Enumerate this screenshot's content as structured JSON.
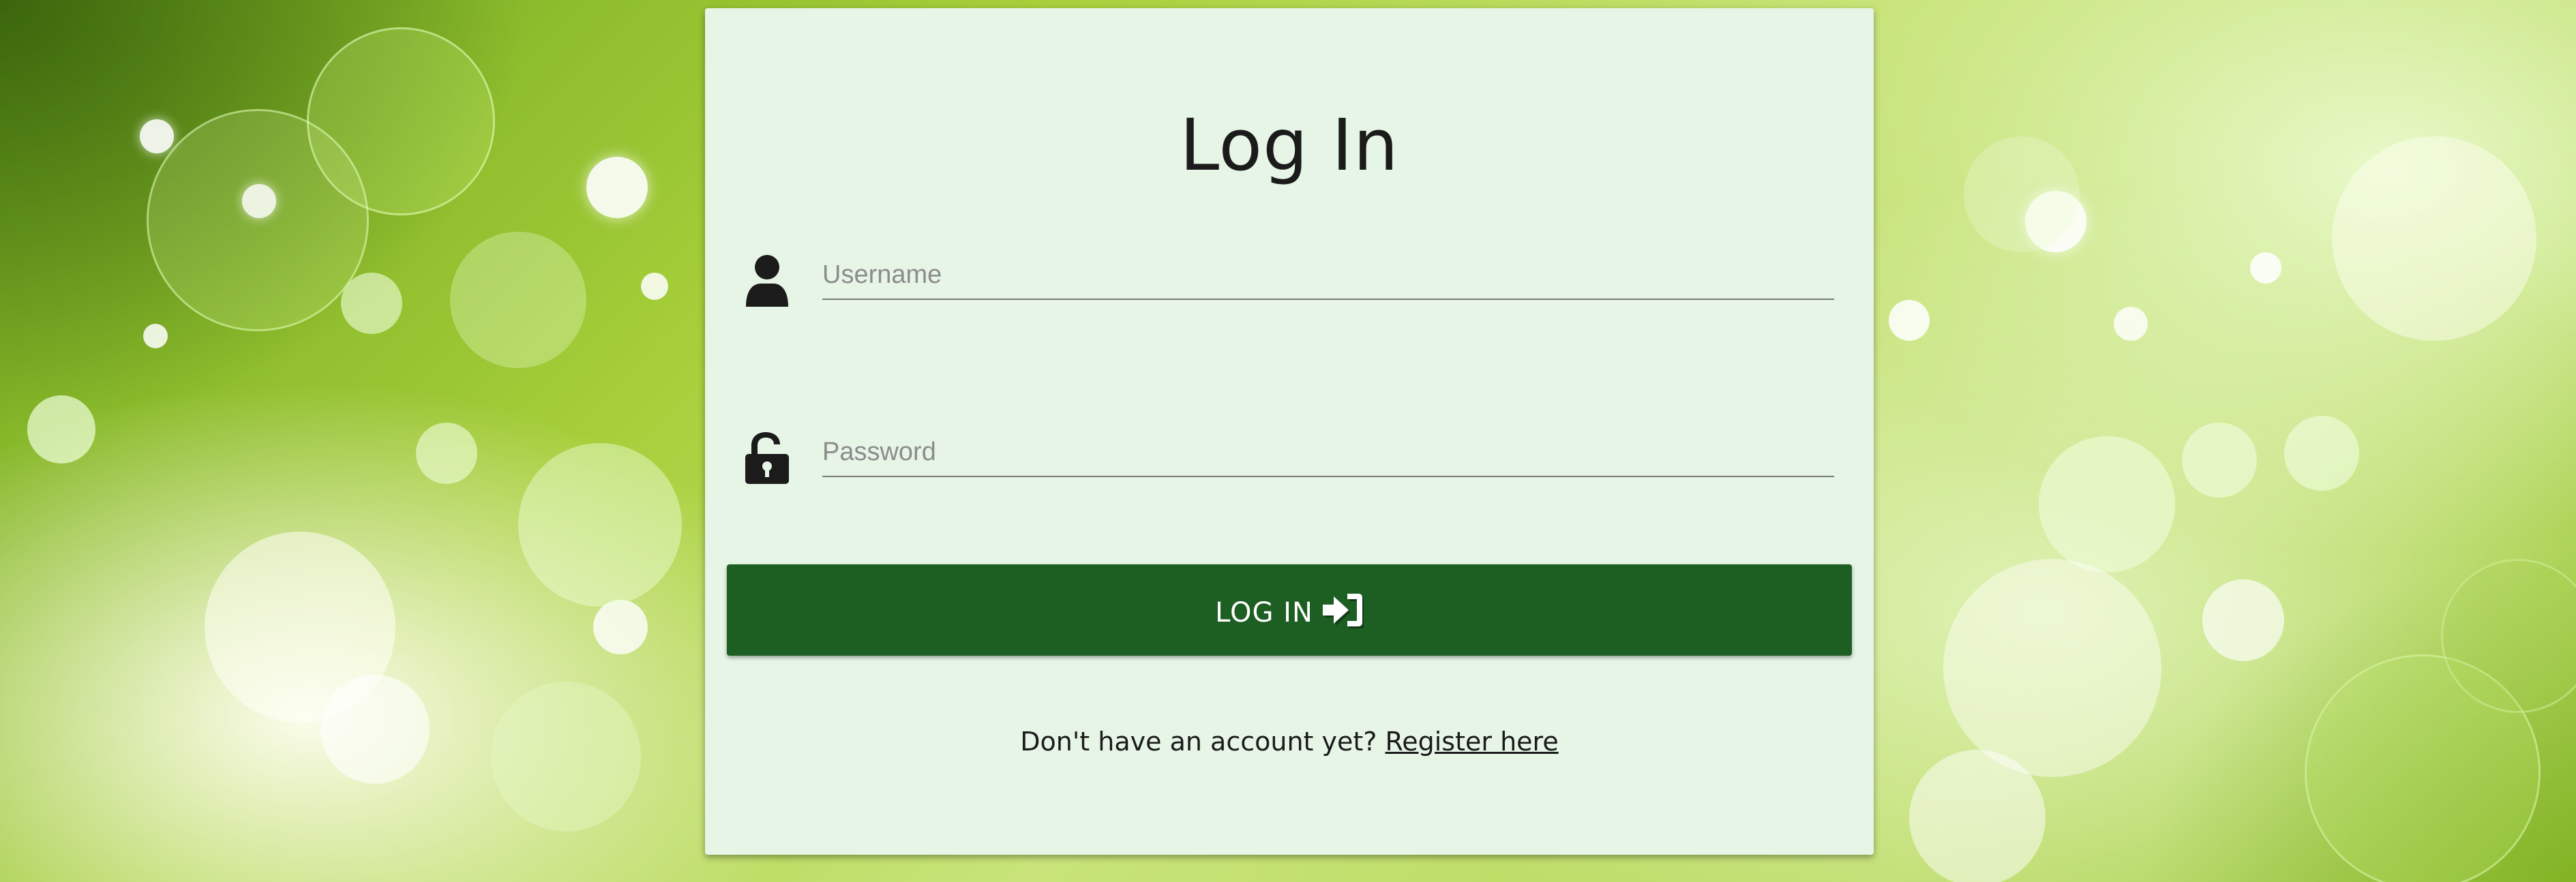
{
  "page": {
    "title": "Log In"
  },
  "form": {
    "username": {
      "placeholder": "Username",
      "value": "",
      "icon": "user-icon"
    },
    "password": {
      "placeholder": "Password",
      "value": "",
      "icon": "unlock-icon"
    },
    "login_button": {
      "label": "LOG IN",
      "icon": "sign-in-icon"
    },
    "register": {
      "prompt": "Don't have an account yet?",
      "link_label": "Register here"
    }
  },
  "colors": {
    "panel_bg": "#e6f5e6",
    "button_bg": "#1d5e22",
    "button_text": "#ffffff",
    "text": "#1b1b1b",
    "background_accent": "#a7cf3a"
  }
}
